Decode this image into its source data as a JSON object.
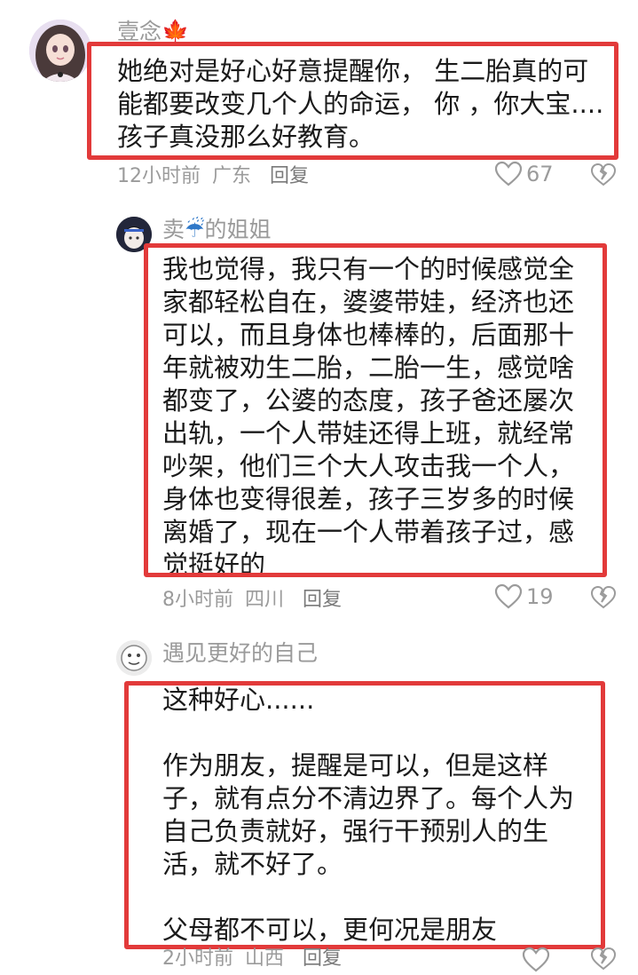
{
  "comments": [
    {
      "username": "壹念",
      "username_emoji": "🍁",
      "lines": [
        "她绝对是好心好意提醒你， 生二胎真的可",
        "能都要改变几个人的命运， 你 ，你大宝....",
        "孩子真没那么好教育。"
      ],
      "time": "12小时前",
      "location": "广东",
      "reply_label": "回复",
      "likes": "67"
    },
    {
      "username_prefix": "卖",
      "username_emoji": "☔",
      "username_suffix": "的姐姐",
      "lines": [
        "我也觉得，我只有一个的时候感觉全",
        "家都轻松自在，婆婆带娃，经济也还",
        "可以，而且身体也棒棒的，后面那十",
        "年就被劝生二胎，二胎一生，感觉啥",
        "都变了，公婆的态度，孩子爸还屡次",
        "出轨，一个人带娃还得上班，就经常",
        "吵架，他们三个大人攻击我一个人，",
        "身体也变得很差，孩子三岁多的时候",
        "离婚了，现在一个人带着孩子过，感",
        "觉挺好的"
      ],
      "time": "8小时前",
      "location": "四川",
      "reply_label": "回复",
      "likes": "19"
    },
    {
      "username": "遇见更好的自己",
      "lines": [
        "这种好心......",
        "",
        "作为朋友，提醒是可以，但是这样",
        "子，就有点分不清边界了。每个人为",
        "自己负责就好，强行干预别人的生",
        "活，就不好了。",
        "",
        "父母都不可以，更何况是朋友"
      ],
      "time": "2小时前",
      "location": "山西",
      "reply_label": "回复"
    }
  ],
  "colors": {
    "highlight": "#e23a3a",
    "meta": "#9b9b9b",
    "username": "#9a9a9a"
  }
}
